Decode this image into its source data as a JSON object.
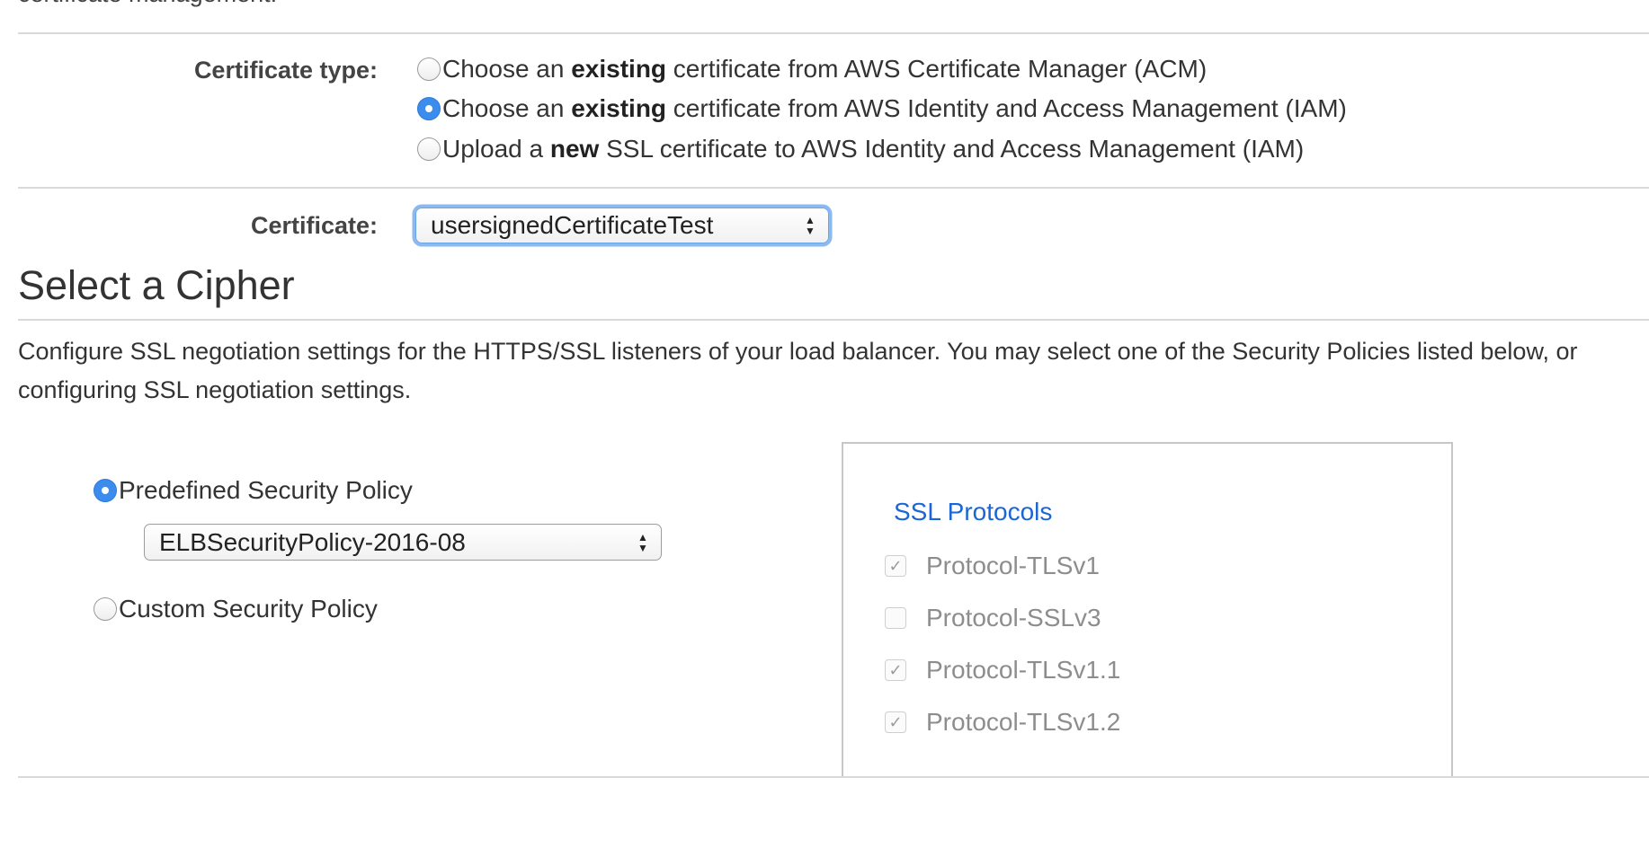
{
  "top_cutoff_text": "certificate management.",
  "certificate_type": {
    "label": "Certificate type:",
    "options": [
      {
        "pre": "Choose an ",
        "bold": "existing",
        "post": " certificate from AWS Certificate Manager (ACM)",
        "selected": false
      },
      {
        "pre": "Choose an ",
        "bold": "existing",
        "post": " certificate from AWS Identity and Access Management (IAM)",
        "selected": true
      },
      {
        "pre": "Upload a ",
        "bold": "new",
        "post": " SSL certificate to AWS Identity and Access Management (IAM)",
        "selected": false
      }
    ]
  },
  "certificate": {
    "label": "Certificate:",
    "selected_value": "usersignedCertificateTest"
  },
  "cipher_section": {
    "title": "Select a Cipher",
    "description_line1": "Configure SSL negotiation settings for the HTTPS/SSL listeners of your load balancer. You may select one of the Security Policies listed below, or",
    "description_line2": "configuring SSL negotiation settings."
  },
  "policy": {
    "predefined_label": "Predefined Security Policy",
    "predefined_selected": true,
    "predefined_value": "ELBSecurityPolicy-2016-08",
    "custom_label": "Custom Security Policy",
    "custom_selected": false
  },
  "ssl_protocols": {
    "title": "SSL Protocols",
    "items": [
      {
        "label": "Protocol-TLSv1",
        "checked": true
      },
      {
        "label": "Protocol-SSLv3",
        "checked": false
      },
      {
        "label": "Protocol-TLSv1.1",
        "checked": true
      },
      {
        "label": "Protocol-TLSv1.2",
        "checked": true
      }
    ]
  },
  "colors": {
    "accent_blue": "#3b8ced",
    "link_blue": "#1a66d6",
    "disabled_gray": "#8d8d8d"
  }
}
